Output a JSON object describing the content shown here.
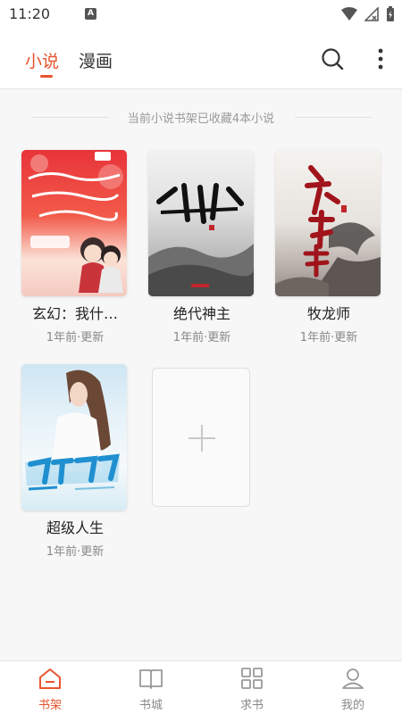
{
  "status": {
    "time": "11:20",
    "notification_icon": "A"
  },
  "header": {
    "tabs": [
      {
        "label": "小说",
        "active": true
      },
      {
        "label": "漫画",
        "active": false
      }
    ],
    "accent_color": "#e8542f"
  },
  "summary": "当前小说书架已收藏4本小说",
  "books": [
    {
      "title": "玄幻：我什…",
      "updated": "1年前·更新",
      "cover_text": "我什么时候无敌了"
    },
    {
      "title": "绝代神主",
      "updated": "1年前·更新",
      "cover_text": "绝代神主"
    },
    {
      "title": "牧龙师",
      "updated": "1年前·更新",
      "cover_text": "牧龙师"
    },
    {
      "title": "超级人生",
      "updated": "1年前·更新",
      "cover_text": "超级人生"
    }
  ],
  "bottom_nav": [
    {
      "label": "书架",
      "icon": "house-icon",
      "active": true
    },
    {
      "label": "书城",
      "icon": "book-icon",
      "active": false
    },
    {
      "label": "求书",
      "icon": "grid-icon",
      "active": false
    },
    {
      "label": "我的",
      "icon": "person-icon",
      "active": false
    }
  ]
}
